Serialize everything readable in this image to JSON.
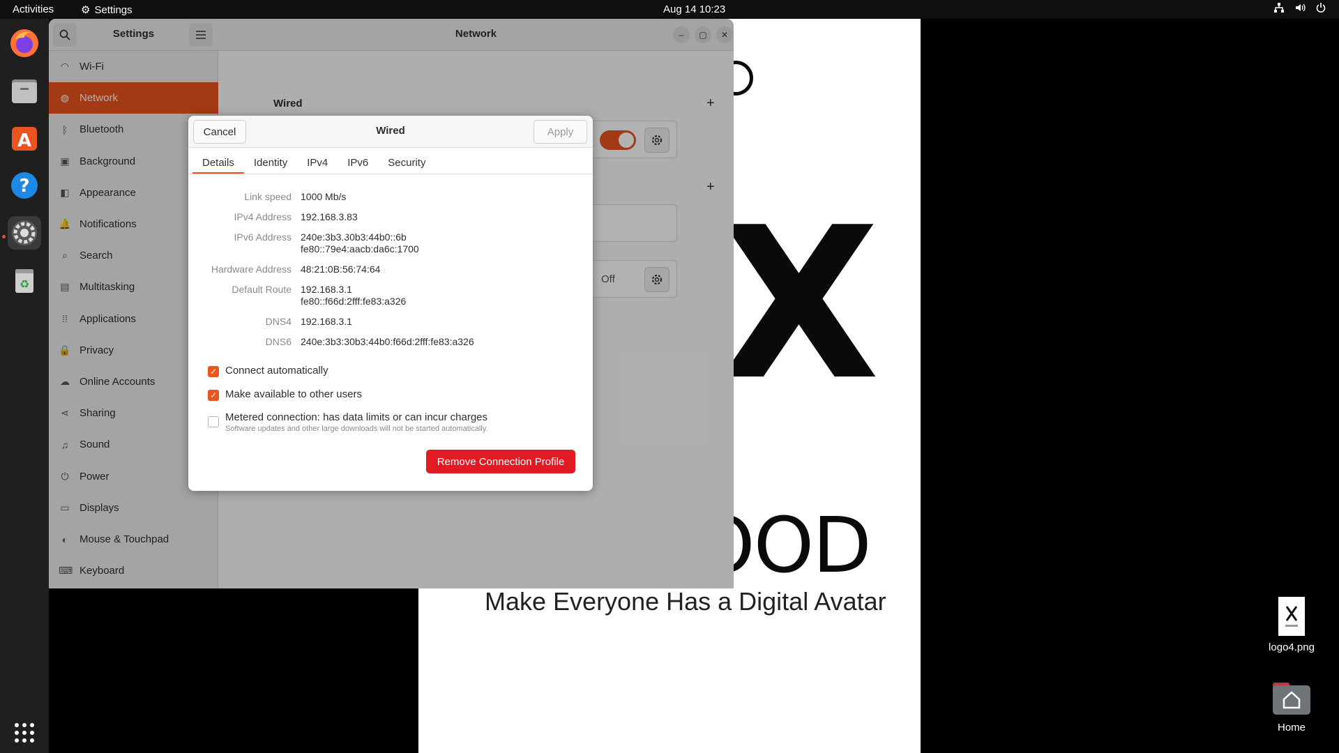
{
  "topbar": {
    "activities": "Activities",
    "app_name": "Settings",
    "clock": "Aug 14  10:23"
  },
  "wallpaper": {
    "letters_top": "X",
    "letters_bottom": "OOD",
    "tagline": "Make Everyone Has a Digital Avatar"
  },
  "desktop": {
    "file_label": "logo4.png",
    "home_label": "Home"
  },
  "settings": {
    "sidebar_title": "Settings",
    "window_title": "Network",
    "items": [
      {
        "label": "Wi-Fi",
        "icon": "wifi-icon"
      },
      {
        "label": "Network",
        "icon": "network-icon"
      },
      {
        "label": "Bluetooth",
        "icon": "bluetooth-icon"
      },
      {
        "label": "Background",
        "icon": "background-icon"
      },
      {
        "label": "Appearance",
        "icon": "appearance-icon"
      },
      {
        "label": "Notifications",
        "icon": "bell-icon"
      },
      {
        "label": "Search",
        "icon": "search-icon"
      },
      {
        "label": "Multitasking",
        "icon": "multitasking-icon"
      },
      {
        "label": "Applications",
        "icon": "grid-icon"
      },
      {
        "label": "Privacy",
        "icon": "lock-icon"
      },
      {
        "label": "Online Accounts",
        "icon": "cloud-icon"
      },
      {
        "label": "Sharing",
        "icon": "share-icon"
      },
      {
        "label": "Sound",
        "icon": "music-icon"
      },
      {
        "label": "Power",
        "icon": "power-icon"
      },
      {
        "label": "Displays",
        "icon": "display-icon"
      },
      {
        "label": "Mouse & Touchpad",
        "icon": "mouse-icon"
      },
      {
        "label": "Keyboard",
        "icon": "keyboard-icon"
      }
    ],
    "wired_section": "Wired",
    "vpn_off": "Off"
  },
  "dialog": {
    "cancel": "Cancel",
    "title": "Wired",
    "apply": "Apply",
    "tabs": [
      "Details",
      "Identity",
      "IPv4",
      "IPv6",
      "Security"
    ],
    "details": {
      "link_speed_label": "Link speed",
      "link_speed": "1000 Mb/s",
      "ipv4_label": "IPv4 Address",
      "ipv4": "192.168.3.83",
      "ipv6_label": "IPv6 Address",
      "ipv6_1": "240e:3b3:30b3:44b0::6b",
      "ipv6_2": "fe80::79e4:aacb:da6c:1700",
      "hw_label": "Hardware Address",
      "hw": "48:21:0B:56:74:64",
      "route_label": "Default Route",
      "route_1": "192.168.3.1",
      "route_2": "fe80::f66d:2fff:fe83:a326",
      "dns4_label": "DNS4",
      "dns4": "192.168.3.1",
      "dns6_label": "DNS6",
      "dns6": "240e:3b3:30b3:44b0:f66d:2fff:fe83:a326"
    },
    "connect_auto": "Connect automatically",
    "available_users": "Make available to other users",
    "metered": "Metered connection: has data limits or can incur charges",
    "metered_sub": "Software updates and other large downloads will not be started automatically.",
    "remove": "Remove Connection Profile"
  },
  "colors": {
    "accent": "#e95420",
    "destructive": "#e01b24"
  }
}
